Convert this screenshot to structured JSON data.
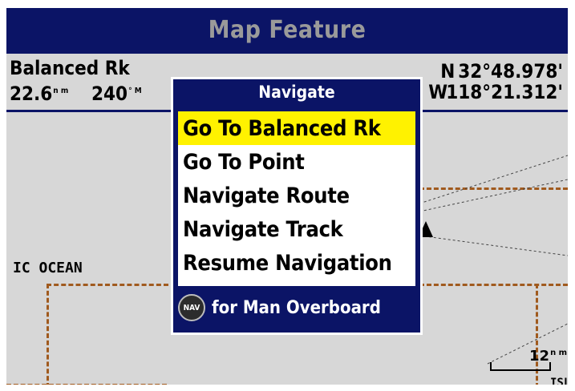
{
  "screen": {
    "title": "Map Feature"
  },
  "info": {
    "name": "Balanced Rk",
    "distance": "22.6",
    "distance_unit": "n m",
    "bearing": "240",
    "bearing_unit": "° M",
    "lat_hemisphere": "N",
    "lat_value": "32°48.978'",
    "lon_hemisphere": "W",
    "lon_value": "118°21.312'"
  },
  "map": {
    "ocean_label": "IC OCEAN",
    "scale_label": "12",
    "scale_unit": "n m",
    "island_label": "ISL"
  },
  "menu": {
    "title": "Navigate",
    "items": [
      {
        "label": "Go To Balanced Rk",
        "selected": true
      },
      {
        "label": "Go To Point",
        "selected": false
      },
      {
        "label": "Navigate Route",
        "selected": false
      },
      {
        "label": "Navigate Track",
        "selected": false
      },
      {
        "label": "Resume Navigation",
        "selected": false
      }
    ],
    "footer_button": "NAV",
    "footer_text": "for Man Overboard"
  },
  "colors": {
    "frame": "#0b1466",
    "highlight": "#fff200",
    "map_bg": "#d7d7d7",
    "boundary": "#a05a1e"
  }
}
